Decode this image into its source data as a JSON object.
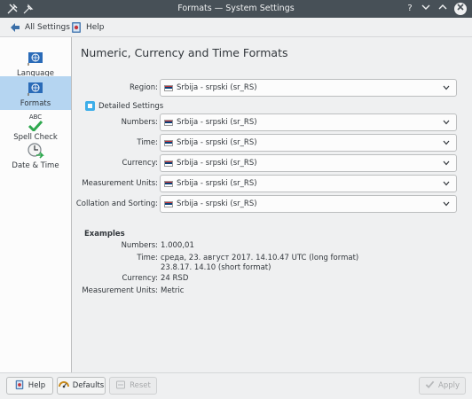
{
  "window": {
    "title": "Formats — System Settings"
  },
  "toolbar": {
    "all_settings_label": "All Settings",
    "help_label": "Help"
  },
  "sidebar": {
    "items": [
      {
        "label": "Language",
        "active": false
      },
      {
        "label": "Formats",
        "active": true
      },
      {
        "label": "Spell Check",
        "icon_text": "ABC",
        "active": false
      },
      {
        "label": "Date & Time",
        "active": false
      }
    ]
  },
  "main": {
    "title": "Numeric, Currency and Time Formats",
    "region": {
      "label": "Region:",
      "value": "Srbija - srpski (sr_RS)"
    },
    "detailed_settings": {
      "label": "Detailed Settings",
      "checked": true
    },
    "rows": [
      {
        "label": "Numbers:",
        "value": "Srbija - srpski (sr_RS)"
      },
      {
        "label": "Time:",
        "value": "Srbija - srpski (sr_RS)"
      },
      {
        "label": "Currency:",
        "value": "Srbija - srpski (sr_RS)"
      },
      {
        "label": "Measurement Units:",
        "value": "Srbija - srpski (sr_RS)"
      },
      {
        "label": "Collation and Sorting:",
        "value": "Srbija - srpski (sr_RS)"
      }
    ],
    "examples": {
      "title": "Examples",
      "numbers_label": "Numbers:",
      "numbers_value": "1.000,01",
      "time_label": "Time:",
      "time_value_long": "среда, 23. август 2017. 14.10.47 UTC (long format)",
      "time_value_short": "23.8.17. 14.10 (short format)",
      "currency_label": "Currency:",
      "currency_value": "24 RSD",
      "measurement_label": "Measurement Units:",
      "measurement_value": "Metric"
    }
  },
  "bottom": {
    "help_label": "Help",
    "defaults_label": "Defaults",
    "reset_label": "Reset",
    "apply_label": "Apply"
  },
  "colors": {
    "accent": "#3daee9",
    "titlebar": "#475057",
    "selection": "#b5d5f1"
  }
}
